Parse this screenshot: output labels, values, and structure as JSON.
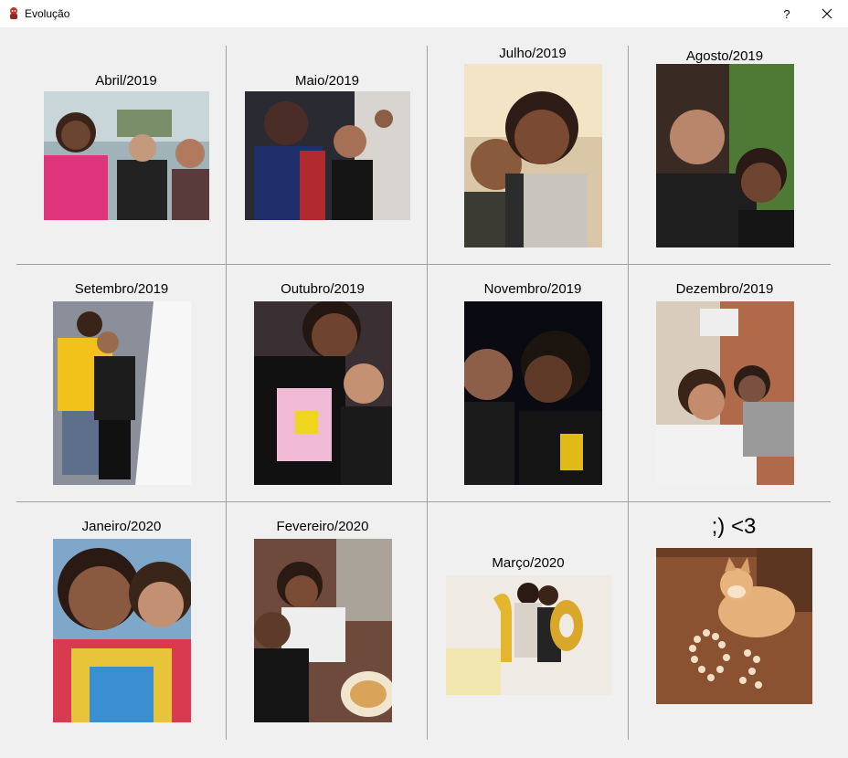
{
  "window": {
    "title": "Evolução",
    "help_label": "?",
    "close_label": "✕"
  },
  "cells": [
    {
      "caption": "Abril/2019",
      "icon": "photo-icon"
    },
    {
      "caption": "Maio/2019",
      "icon": "photo-icon"
    },
    {
      "caption": "Julho/2019",
      "icon": "photo-icon"
    },
    {
      "caption": "Agosto/2019",
      "icon": "photo-icon"
    },
    {
      "caption": "Setembro/2019",
      "icon": "photo-icon"
    },
    {
      "caption": "Outubro/2019",
      "icon": "photo-icon"
    },
    {
      "caption": "Novembro/2019",
      "icon": "photo-icon"
    },
    {
      "caption": "Dezembro/2019",
      "icon": "photo-icon"
    },
    {
      "caption": "Janeiro/2020",
      "icon": "photo-icon"
    },
    {
      "caption": "Fevereiro/2020",
      "icon": "photo-icon"
    },
    {
      "caption": "Março/2020",
      "icon": "photo-icon"
    },
    {
      "caption": ";) <3",
      "icon": "dog-photo-icon"
    }
  ],
  "colors": {
    "background": "#f0f0f0",
    "titlebar": "#ffffff",
    "grid_line": "#a0a0a0"
  }
}
